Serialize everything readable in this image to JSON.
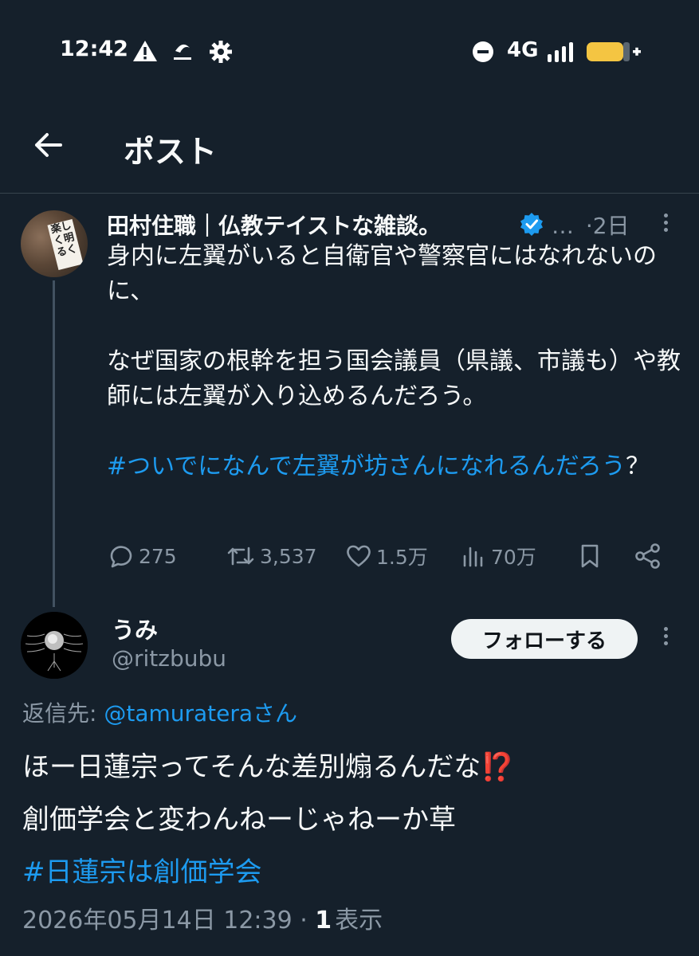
{
  "status_bar": {
    "time": "12:42",
    "network": "4G",
    "battery_color": "#f4c542",
    "icons": [
      "warning-icon",
      "app-notification-icon",
      "settings-gear-icon",
      "do-not-disturb-icon",
      "signal-icon",
      "battery-icon"
    ]
  },
  "header": {
    "title": "ポスト",
    "back_icon": "back-arrow-icon"
  },
  "original_post": {
    "author_name": "田村住職｜仏教テイストな雑談。",
    "verified": true,
    "ellipsis": "…",
    "time": "·2日",
    "avatar_sign": "楽しく明るく",
    "paragraph1": "身内に左翼がいると自衛官や警察官にはなれないのに、",
    "paragraph2": "なぜ国家の根幹を担う国会議員（県議、市議も）や教師には左翼が入り込めるんだろう。",
    "hashtag": "#ついでになんで左翼が坊さんになれるんだろう",
    "hashtag_suffix": "？",
    "stats": {
      "replies": "275",
      "reposts": "3,537",
      "likes": "1.5万",
      "views": "70万"
    }
  },
  "reply_post": {
    "author_name": "うみ",
    "handle": "@ritzbubu",
    "follow_label": "フォローする",
    "reply_to_label": "返信先: ",
    "reply_to_mention": "@tamuraterаさん",
    "line1": "ほー日蓮宗ってそんな差別煽るんだな⁉️",
    "line2": "創価学会と変わんねーじゃねーか草",
    "hashtag": "#日蓮宗は創価学会",
    "timestamp": "2026年05月14日 12:39 · ",
    "view_count": "1",
    "view_label": "表示"
  },
  "colors": {
    "background": "#15202b",
    "link": "#1d9bf0",
    "secondary_text": "#8b98a5"
  }
}
